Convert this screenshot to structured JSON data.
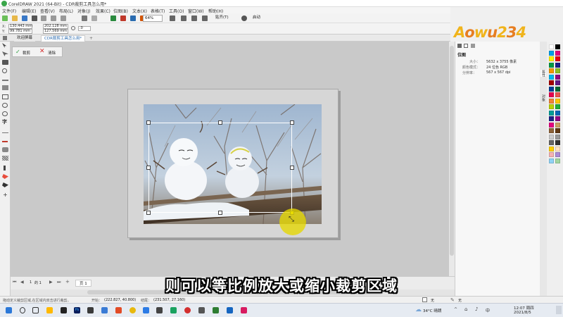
{
  "window": {
    "title": "CorelDRAW 2021 (64-Bit) - CDR裁剪工具怎么用*"
  },
  "menu": [
    "文件(F)",
    "编辑(E)",
    "查看(V)",
    "布局(L)",
    "对象(J)",
    "效果(C)",
    "位图(B)",
    "文本(X)",
    "表格(T)",
    "工具(O)",
    "窗口(W)",
    "帮助(H)"
  ],
  "toolbar": {
    "zoom_value": "64%",
    "snap_label": "贴齐(T)",
    "launch_label": "启动"
  },
  "propbar": {
    "x_label": "X:",
    "x_value": "130.443 mm",
    "y_label": "Y:",
    "y_value": "99.781 mm",
    "w_value": "202.128 mm",
    "h_value": "127.569 mm",
    "angle_value": ".0"
  },
  "tabs": {
    "welcome": "欢迎屏幕",
    "document": "CDR裁剪工具怎么用*"
  },
  "crop_bar": {
    "crop_label": "裁剪",
    "clear_label": "清除"
  },
  "docker": {
    "heading": "位图",
    "size_label": "大小：",
    "size_value": "5632 x 3755 像素",
    "color_label": "颜色模式：",
    "color_value": "24 位色 RGB",
    "res_label": "分辨率：",
    "res_value": "567 x 567 dpi"
  },
  "dock_tabs": [
    "属性",
    "对象"
  ],
  "page_nav": {
    "current": "1",
    "of": "的 1",
    "page_tab": "页 1"
  },
  "status": {
    "hint": "拖动定义裁剪区域,在区域内双击进行裁剪。",
    "start_label": "开始：",
    "start_value": "(222.827, 40.800)",
    "end_label": "结尾：",
    "end_value": "(231.507, 27.160)",
    "fill_none": "无",
    "outline_none": "无"
  },
  "taskbar": {
    "temp": "34°C 晴朗",
    "input": "中",
    "time": "12:07 周四",
    "date": "2021/8/5"
  },
  "logo": {
    "text": "Aowu234"
  },
  "subtitle": "则可以等比例放大或缩小裁剪区域",
  "colors": {
    "accent": "#3aa64a",
    "palette": [
      "#ffffff",
      "#000000",
      "#00a0e9",
      "#e4007f",
      "#fff100",
      "#e60012",
      "#009944",
      "#1d2088",
      "#f39800",
      "#8fc31f",
      "#00b7ee",
      "#920783",
      "#a40000",
      "#601986",
      "#004098",
      "#006934",
      "#e5004f",
      "#ea5550",
      "#f08437",
      "#fcc800",
      "#b8d200",
      "#22ac38",
      "#009e96",
      "#0068b7",
      "#1d2088",
      "#920783",
      "#e4007f",
      "#c9a063",
      "#8c6239",
      "#603813",
      "#cccccc",
      "#999999",
      "#666666",
      "#333333",
      "#fdd000",
      "#ffe4c4",
      "#f5b2b2",
      "#ab8ad6",
      "#8fd3f5",
      "#a3d6a0"
    ]
  }
}
